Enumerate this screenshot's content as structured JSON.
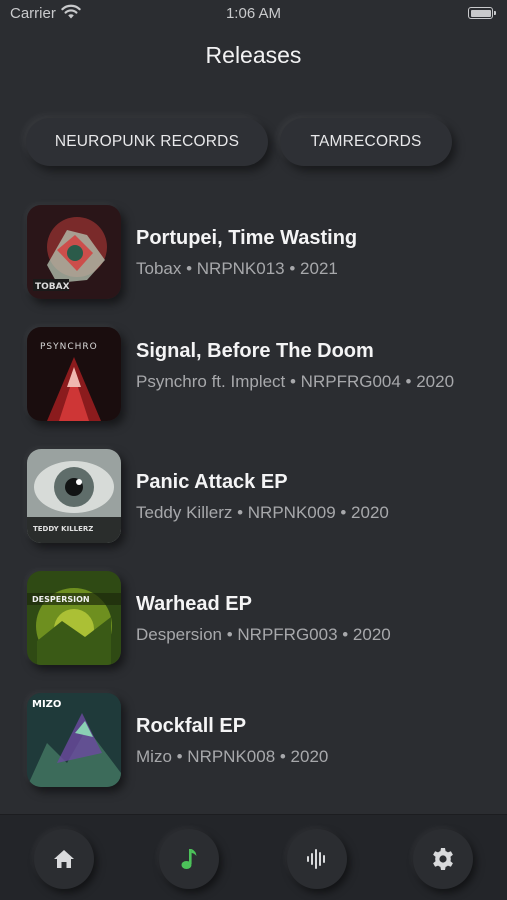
{
  "status_bar": {
    "carrier": "Carrier",
    "time": "1:06 AM"
  },
  "page": {
    "title": "Releases"
  },
  "labels": [
    "NEUROPUNK RECORDS",
    "TAMRECORDS"
  ],
  "releases": [
    {
      "title": "Portupei, Time Wasting",
      "meta": "Tobax • NRPNK013 • 2021",
      "cover_text": "TOBAX"
    },
    {
      "title": "Signal, Before The Doom",
      "meta": "Psynchro ft. Implect • NRPFRG004 • 2020",
      "cover_text": "PSYNCHRO"
    },
    {
      "title": "Panic Attack EP",
      "meta": "Teddy Killerz • NRPNK009 • 2020",
      "cover_text": "TEDDY KILLERZ"
    },
    {
      "title": "Warhead EP",
      "meta": "Despersion • NRPFRG003 • 2020",
      "cover_text": "DESPERSION"
    },
    {
      "title": "Rockfall EP",
      "meta": "Mizo • NRPNK008 • 2020",
      "cover_text": "MIZO"
    }
  ],
  "tab_bar": {
    "items": [
      {
        "icon": "home-icon",
        "active": false
      },
      {
        "icon": "music-note-icon",
        "active": true
      },
      {
        "icon": "waveform-icon",
        "active": false
      },
      {
        "icon": "gear-icon",
        "active": false
      }
    ],
    "accent": "#4cc25a",
    "inactive": "#d9dadc"
  }
}
